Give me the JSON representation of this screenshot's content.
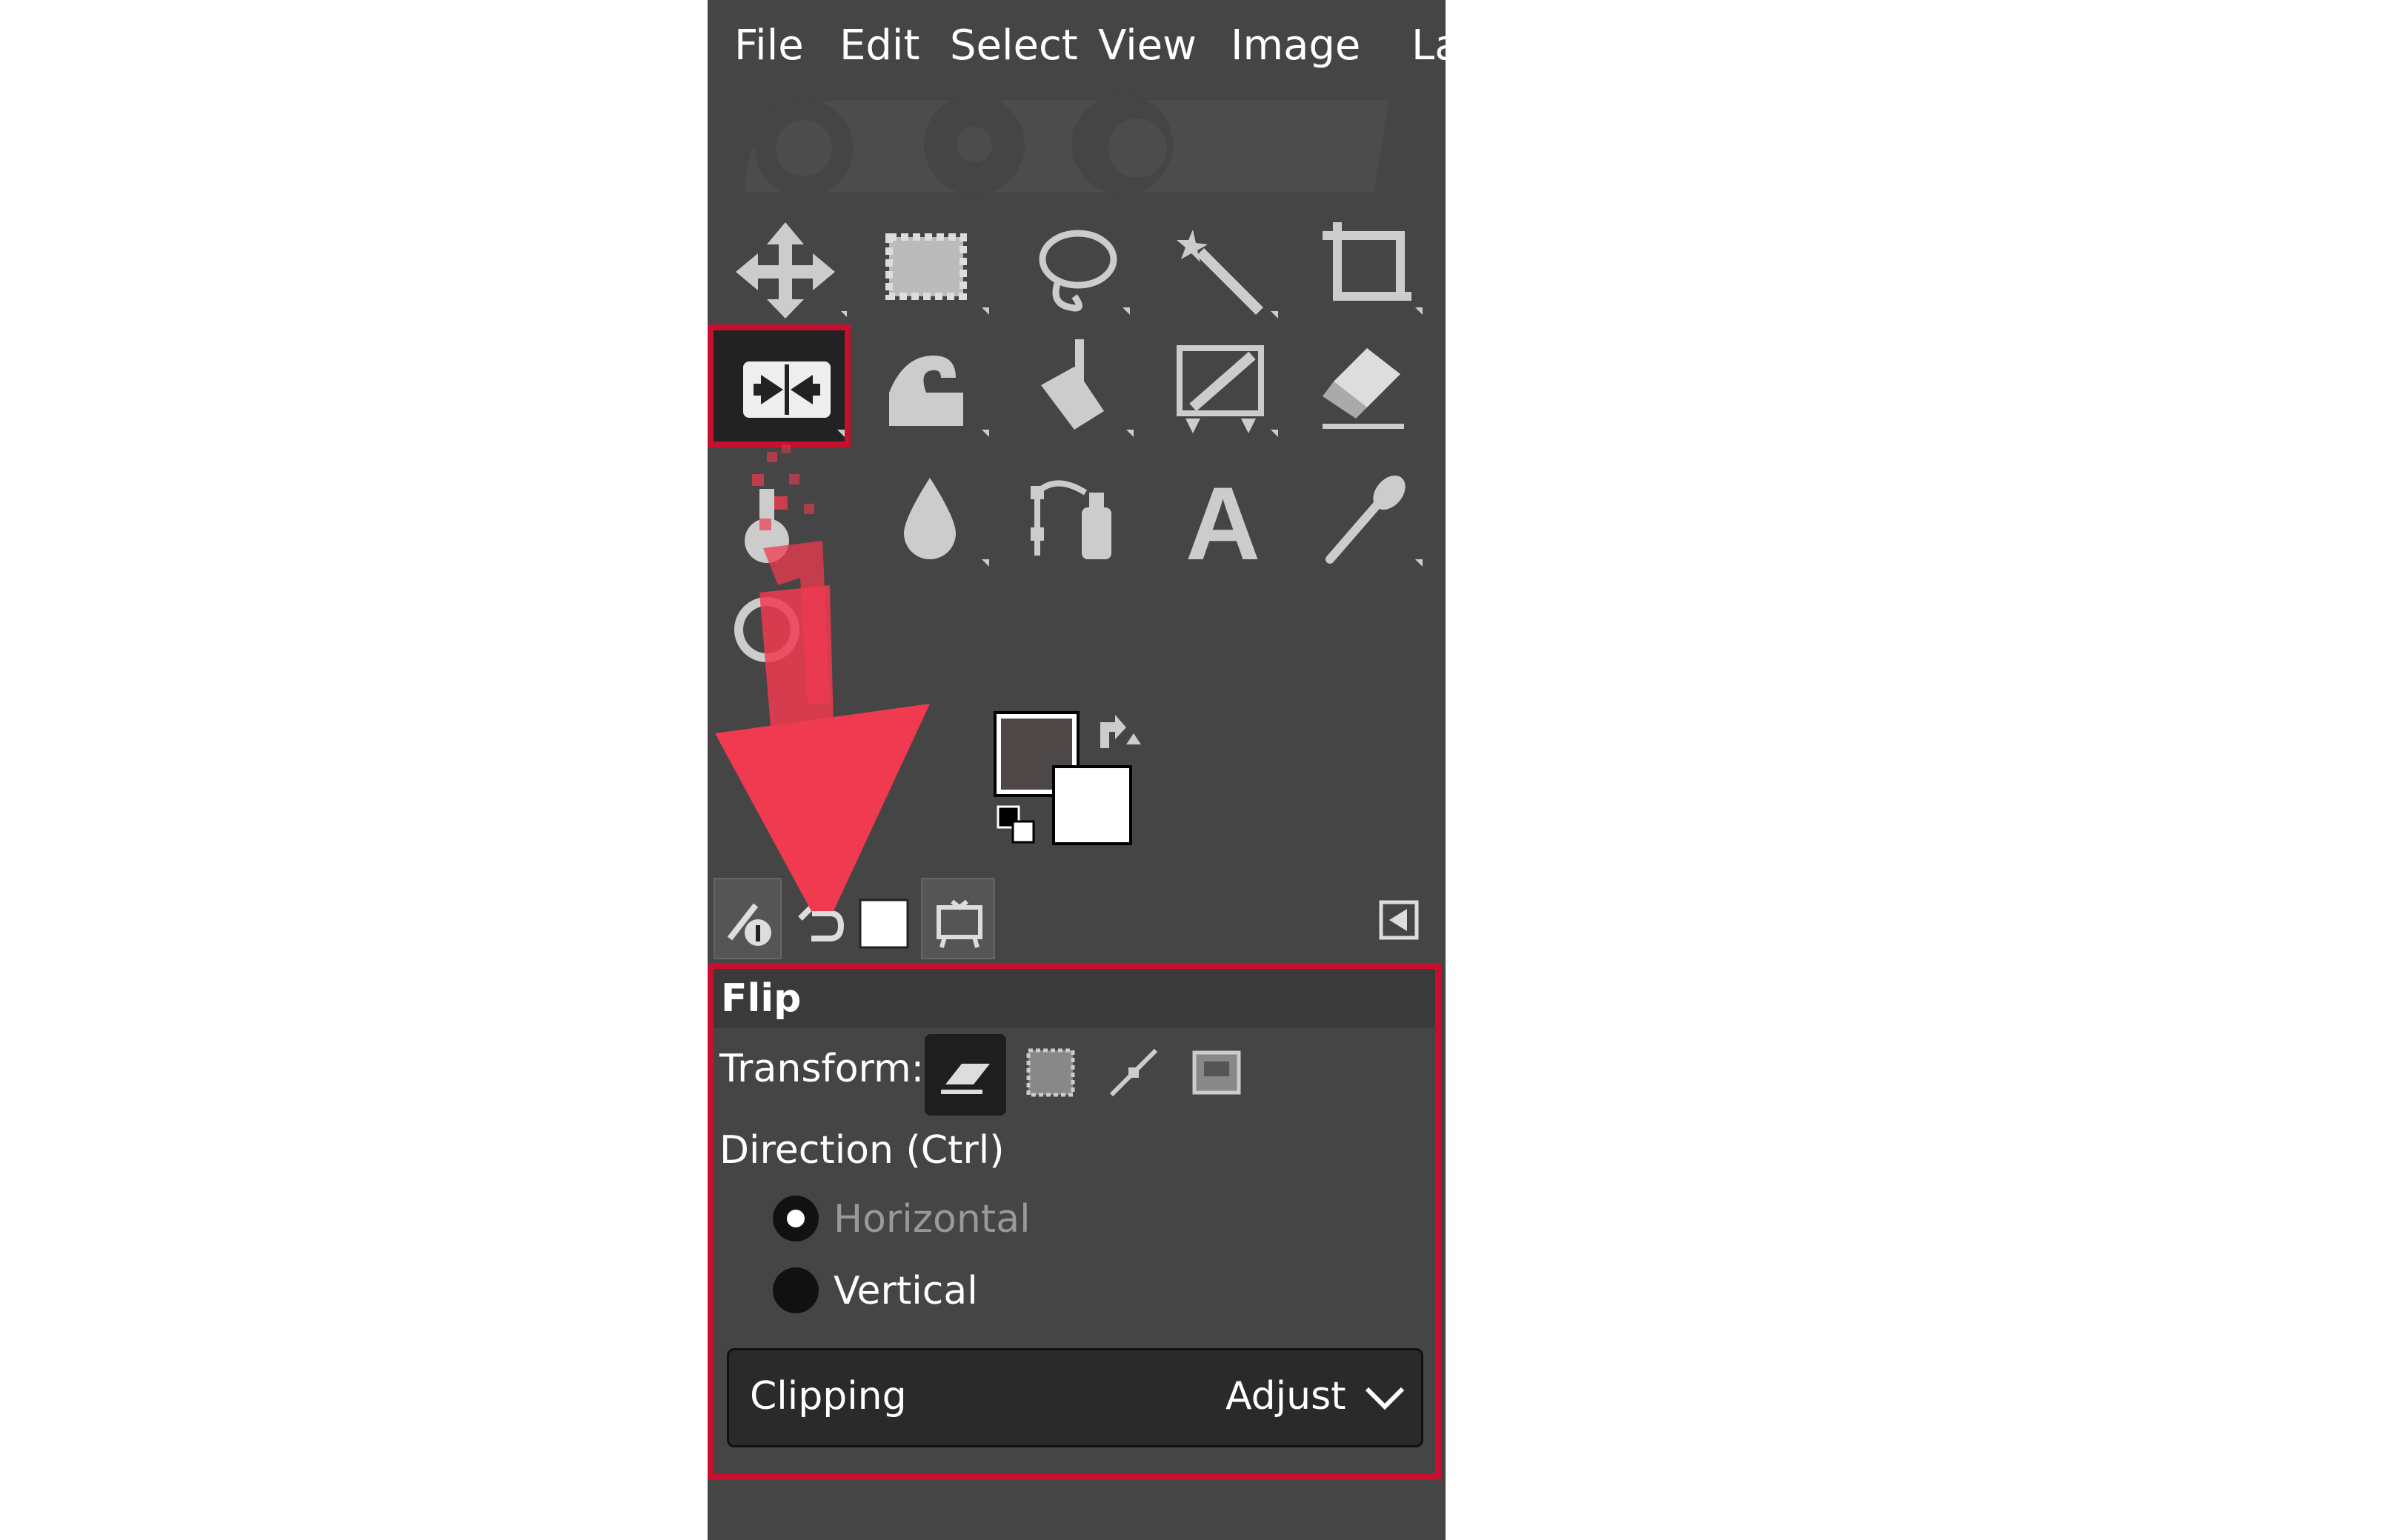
{
  "menu": {
    "items": [
      "File",
      "Edit",
      "Select",
      "View",
      "Image",
      "La"
    ]
  },
  "toolbox": {
    "rows": [
      [
        "move-tool-icon",
        "rect-select-tool-icon",
        "free-select-tool-icon",
        "fuzzy-select-tool-icon",
        "crop-tool-icon"
      ],
      [
        "flip-tool-icon",
        "warp-transform-tool-icon",
        "bucket-fill-tool-icon",
        "mypaint-brush-tool-icon",
        "eraser-tool-icon"
      ],
      [
        "clone-tool-icon",
        "blur-tool-icon",
        "paths-tool-icon",
        "text-tool-icon",
        "color-picker-tool-icon"
      ],
      [
        "zoom-tool-icon"
      ]
    ],
    "selected_tool": "flip-tool-icon",
    "text_tool_glyph": "A"
  },
  "colors": {
    "foreground": "#4d4747",
    "background": "#ffffff",
    "accent_highlight": "#c8102e",
    "arrow": "#f03a50"
  },
  "dock_tabs": [
    "tool-options-icon",
    "undo-history-icon",
    "brush-icon",
    "images-icon"
  ],
  "tool_options": {
    "title": "Flip",
    "transform_label": "Transform:",
    "transform_modes": [
      "layer-icon",
      "selection-icon",
      "path-icon",
      "image-icon"
    ],
    "direction_label": "Direction  (Ctrl)",
    "direction_options": [
      {
        "label": "Horizontal",
        "checked": true
      },
      {
        "label": "Vertical",
        "checked": false
      }
    ],
    "clipping_label": "Clipping",
    "clipping_value": "Adjust"
  }
}
